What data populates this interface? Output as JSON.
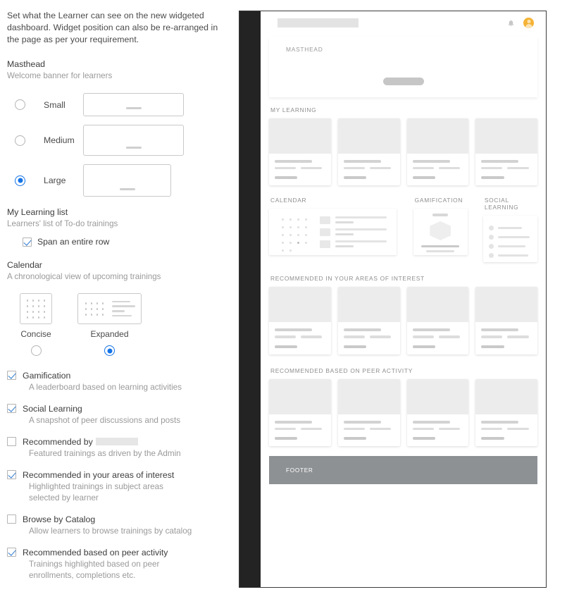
{
  "settings": {
    "intro": "Set what the Learner can see on the new widgeted dashboard. Widget position can also be re-arranged in the page as per your requirement.",
    "masthead": {
      "title": "Masthead",
      "subtitle": "Welcome banner for learners",
      "selected": "Large",
      "options": [
        {
          "label": "Small",
          "selected": false
        },
        {
          "label": "Medium",
          "selected": false
        },
        {
          "label": "Large",
          "selected": true
        }
      ]
    },
    "my_learning": {
      "title": "My Learning list",
      "subtitle": "Learners' list of To-do trainings",
      "span_label": "Span an entire row",
      "span_checked": true
    },
    "calendar": {
      "title": "Calendar",
      "subtitle": "A chronological view of upcoming trainings",
      "selected": "Expanded",
      "options": [
        {
          "label": "Concise",
          "selected": false
        },
        {
          "label": "Expanded",
          "selected": true
        }
      ]
    },
    "features": [
      {
        "title": "Gamification",
        "desc": "A leaderboard based on learning activities",
        "checked": true,
        "redacted": false
      },
      {
        "title": "Social Learning",
        "desc": "A snapshot of peer discussions and posts",
        "checked": true,
        "redacted": false
      },
      {
        "title": "Recommended by",
        "desc": "Featured trainings as driven by the Admin",
        "checked": false,
        "redacted": true
      },
      {
        "title": "Recommended in your areas of interest",
        "desc": "Highlighted trainings in subject areas selected by learner",
        "checked": true,
        "redacted": false
      },
      {
        "title": "Browse by Catalog",
        "desc": "Allow learners to browse trainings by catalog",
        "checked": false,
        "redacted": false
      },
      {
        "title": "Recommended based on peer activity",
        "desc": "Trainings highlighted based on peer enrollments, completions etc.",
        "checked": true,
        "redacted": false
      }
    ]
  },
  "preview": {
    "masthead_caption": "MASTHEAD",
    "sections": {
      "my_learning": "MY LEARNING",
      "calendar": "CALENDAR",
      "gamification": "GAMIFICATION",
      "social_learning": "SOCIAL LEARNING",
      "recommended_interest": "RECOMMENDED IN YOUR AREAS OF INTEREST",
      "recommended_peer": "RECOMMENDED BASED ON PEER ACTIVITY"
    },
    "footer_caption": "FOOTER",
    "card_count": 4
  },
  "colors": {
    "accent": "#1473e6",
    "check": "#2d7ad1",
    "rail": "#232323",
    "footer": "#8e9194",
    "avatar": "#f5b335",
    "placeholder": "#ececec"
  }
}
